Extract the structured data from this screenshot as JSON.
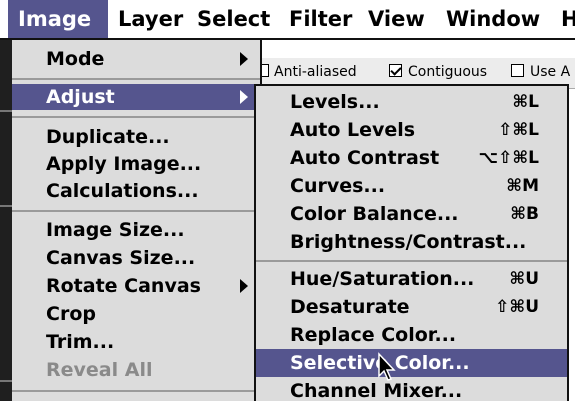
{
  "menubar": {
    "items": [
      "Image",
      "Layer",
      "Select",
      "Filter",
      "View",
      "Window",
      "H"
    ]
  },
  "options": {
    "anti_aliased": "Anti-aliased",
    "contiguous": "Contiguous",
    "use_all": "Use A"
  },
  "image_menu": {
    "mode": "Mode",
    "adjust": "Adjust",
    "duplicate": "Duplicate...",
    "apply_image": "Apply Image...",
    "calculations": "Calculations...",
    "image_size": "Image Size...",
    "canvas_size": "Canvas Size...",
    "rotate_canvas": "Rotate Canvas",
    "crop": "Crop",
    "trim": "Trim...",
    "reveal_all": "Reveal All"
  },
  "adjust_menu": {
    "items": [
      {
        "label": "Levels...",
        "shortcut": "⌘L"
      },
      {
        "label": "Auto Levels",
        "shortcut": "⇧⌘L"
      },
      {
        "label": "Auto Contrast",
        "shortcut": "⌥⇧⌘L"
      },
      {
        "label": "Curves...",
        "shortcut": "⌘M"
      },
      {
        "label": "Color Balance...",
        "shortcut": "⌘B"
      },
      {
        "label": "Brightness/Contrast...",
        "shortcut": ""
      },
      {
        "label": "Hue/Saturation...",
        "shortcut": "⌘U"
      },
      {
        "label": "Desaturate",
        "shortcut": "⇧⌘U"
      },
      {
        "label": "Replace Color...",
        "shortcut": ""
      },
      {
        "label": "Selective Color...",
        "shortcut": ""
      },
      {
        "label": "Channel Mixer...",
        "shortcut": ""
      }
    ]
  },
  "colors": {
    "highlight": "#55558e",
    "menu_bg": "#dcdcdc",
    "disabled": "#8a8a8a"
  }
}
